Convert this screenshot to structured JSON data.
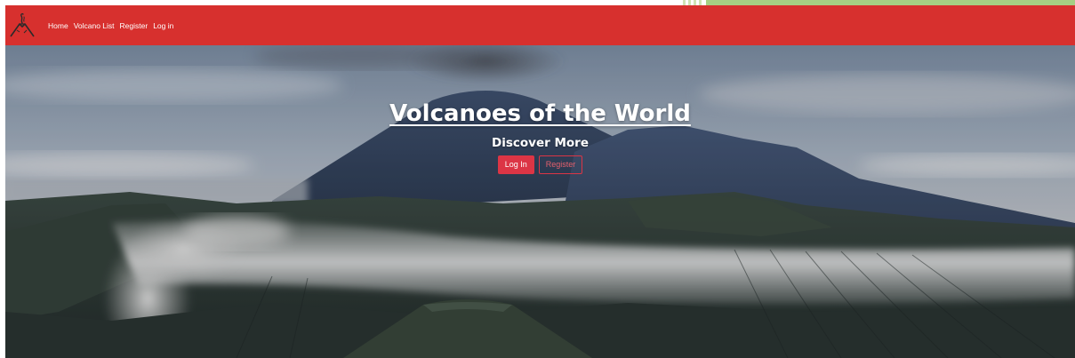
{
  "header": {
    "brand_icon": "volcano-logo-icon",
    "nav": [
      {
        "label": "Home"
      },
      {
        "label": "Volcano List"
      },
      {
        "label": "Register"
      },
      {
        "label": "Log in"
      }
    ]
  },
  "hero": {
    "title": "Volcanoes of the World",
    "subtitle": "Discover More",
    "buttons": {
      "login": "Log In",
      "register": "Register"
    }
  },
  "colors": {
    "navbar": "#d7302e",
    "button_primary": "#dc3545",
    "button_outline_text": "#e4606d",
    "corner_accent": "#a6cf83"
  }
}
